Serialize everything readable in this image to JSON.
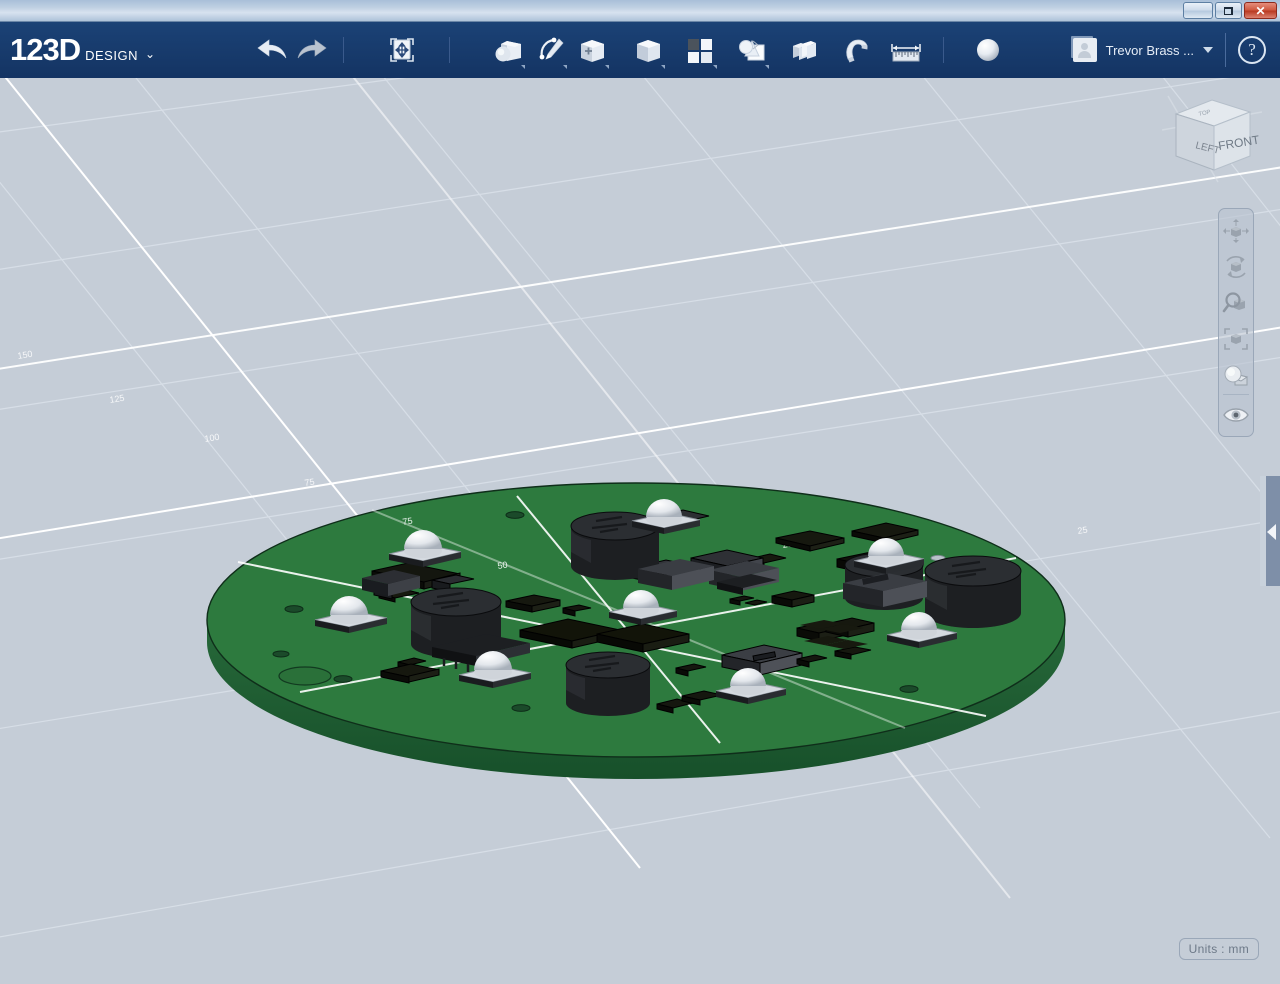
{
  "window": {
    "buttons": [
      {
        "name": "minimize",
        "label": "_"
      },
      {
        "name": "restore",
        "label": ""
      },
      {
        "name": "close",
        "label": "✕"
      }
    ]
  },
  "app": {
    "logo_number": "123D",
    "logo_word": "DESIGN",
    "logo_caret": "⌄"
  },
  "toolbar": {
    "items": [
      {
        "name": "undo-button",
        "label": "Undo",
        "icon": "undo-arrow-icon",
        "has_caret": false
      },
      {
        "name": "redo-button",
        "label": "Redo",
        "icon": "redo-arrow-icon",
        "has_caret": false
      },
      {
        "name": "transform-button",
        "label": "Transform",
        "icon": "transform-move-icon",
        "has_caret": false
      },
      {
        "name": "primitives-button",
        "label": "Primitives",
        "icon": "sphere-cube-icon",
        "has_caret": true
      },
      {
        "name": "sketch-button",
        "label": "Sketch",
        "icon": "pencil-curve-icon",
        "has_caret": true
      },
      {
        "name": "construct-button",
        "label": "Construct",
        "icon": "cube-plus-icon",
        "has_caret": true
      },
      {
        "name": "modify-button",
        "label": "Modify",
        "icon": "cube-icon",
        "has_caret": true
      },
      {
        "name": "pattern-button",
        "label": "Pattern",
        "icon": "four-squares-icon",
        "has_caret": true
      },
      {
        "name": "grouping-button",
        "label": "Grouping",
        "icon": "group-shapes-icon",
        "has_caret": true
      },
      {
        "name": "combine-button",
        "label": "Combine",
        "icon": "combine-cubes-icon",
        "has_caret": false
      },
      {
        "name": "snap-button",
        "label": "Snap",
        "icon": "magnet-icon",
        "has_caret": false
      },
      {
        "name": "measure-button",
        "label": "Measure",
        "icon": "ruler-measure-icon",
        "has_caret": false
      },
      {
        "name": "material-button",
        "label": "Material",
        "icon": "sphere-icon",
        "has_caret": false
      }
    ]
  },
  "account": {
    "avatar_icon": "user-avatar-icon",
    "name": "Trevor Brass ...",
    "caret_icon": "chevron-down-icon",
    "help_label": "?",
    "help_icon": "question-mark-icon"
  },
  "viewport": {
    "background_color": "#c5cdd7",
    "grid_line_color": "#ffffff",
    "grid_labels": [
      "150",
      "125",
      "100",
      "75",
      "50",
      "25"
    ]
  },
  "viewcube": {
    "face_front": "FRONT",
    "face_left": "LEFT",
    "face_top": "TOP"
  },
  "navbar": {
    "items": [
      {
        "name": "pan-tool",
        "label": "Pan",
        "icon": "pan-arrows-icon"
      },
      {
        "name": "orbit-tool",
        "label": "Orbit",
        "icon": "orbit-rotate-icon"
      },
      {
        "name": "zoom-tool",
        "label": "Zoom",
        "icon": "magnifier-icon"
      },
      {
        "name": "fit-tool",
        "label": "Fit",
        "icon": "fit-brackets-icon"
      },
      {
        "name": "display-tool",
        "label": "Display",
        "icon": "shading-sphere-icon"
      },
      {
        "name": "visibility-tool",
        "label": "Visibility",
        "icon": "eye-icon"
      }
    ]
  },
  "status": {
    "units_label": "Units : mm"
  },
  "panel": {
    "handle_icon": "collapse-panel-arrow-icon"
  },
  "model": {
    "name": "circular-pcb-assembly",
    "board_color_top": "#2d7a3e",
    "board_color_edge": "#1d5a2c",
    "board_labels": [
      "75",
      "50",
      "25"
    ],
    "components": {
      "dome_leds": 8,
      "cylinder_caps": 5,
      "chip_packages": 34
    }
  }
}
